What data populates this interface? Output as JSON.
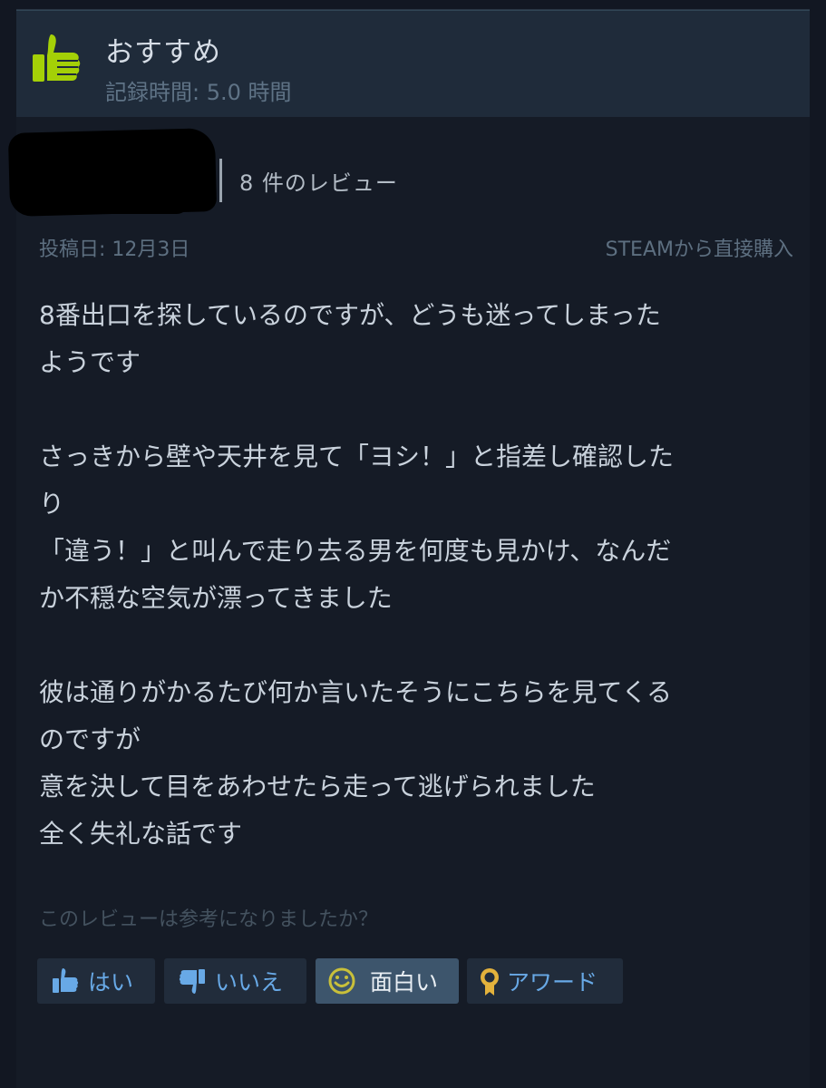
{
  "recommendation": {
    "title": "おすすめ",
    "hours": "記録時間: 5.0 時間",
    "icon": "thumbs-up-icon",
    "icon_color": "#a4d007"
  },
  "author": {
    "review_count": "8 件のレビュー"
  },
  "meta": {
    "posted": "投稿日: 12月3日",
    "source": "STEAMから直接購入"
  },
  "review": {
    "lines": [
      "8番出口を探しているのですが、どうも迷ってしまった",
      "ようです",
      "",
      "さっきから壁や天井を見て「ヨシ！」と指差し確認した",
      "り",
      "「違う！」と叫んで走り去る男を何度も見かけ、なんだ",
      "か不穏な空気が漂ってきました",
      "",
      "彼は通りがかるたび何か言いたそうにこちらを見てくる",
      "のですが",
      "意を決して目をあわせたら走って逃げられました",
      "全く失礼な話です"
    ]
  },
  "helpful": {
    "question": "このレビューは参考になりましたか？",
    "buttons": [
      {
        "label": "はい",
        "icon": "thumbs-up-icon"
      },
      {
        "label": "いいえ",
        "icon": "thumbs-down-icon"
      },
      {
        "label": "面白い",
        "icon": "smiley-icon",
        "active": true
      },
      {
        "label": "アワード",
        "icon": "award-icon"
      }
    ]
  },
  "colors": {
    "background": "#121722",
    "header_bg": "#1f2b3a",
    "link_blue": "#68a9e6",
    "thumb_green": "#a4d007",
    "smiley_yellow": "#c9c03a",
    "award_gold": "#e3b23c"
  }
}
